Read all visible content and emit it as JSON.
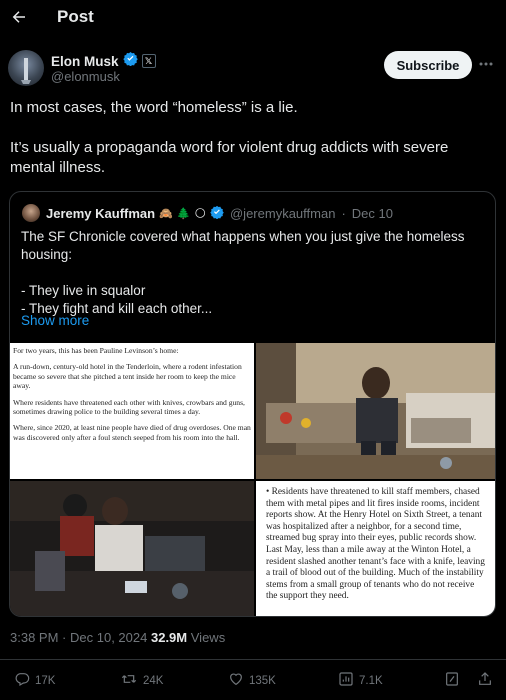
{
  "header": {
    "title": "Post"
  },
  "author": {
    "name": "Elon Musk",
    "handle": "@elonmusk",
    "verified_color": "#1d9bf0"
  },
  "subscribe_label": "Subscribe",
  "post": {
    "para1": "In most cases, the word “homeless” is a lie.",
    "para2": "It’s usually a propaganda word for violent drug addicts with severe mental illness."
  },
  "quote": {
    "name": "Jeremy Kauffman",
    "handle": "@jeremykauffman",
    "separator": "·",
    "date": "Dec 10",
    "emoji": [
      "🙈",
      "🌲",
      "🌕"
    ],
    "text": "The SF Chronicle covered what happens when you just give the homeless housing:\n\n- They live in squalor\n- They fight and kill each other...",
    "show_more": "Show more",
    "article1": [
      "For two years, this has been Pauline Levinson’s home:",
      "A run-down, century-old hotel in the Tenderloin, where a rodent infestation became so severe that she pitched a tent inside her room to keep the mice away.",
      "Where residents have threatened each other with knives, crowbars and guns, sometimes drawing police to the building several times a day.",
      "Where, since 2020, at least nine people have died of drug overdoses. One man was discovered only after a foul stench seeped from his room into the hall."
    ],
    "article2": "• Residents have threatened to kill staff members, chased them with metal pipes and lit fires inside rooms, incident reports show. At the Henry Hotel on Sixth Street, a tenant was hospitalized after a neighbor, for a second time, streamed bug spray into their eyes, public records show. Last May, less than a mile away at the Winton Hotel, a resident slashed another tenant’s face with a knife, leaving a trail of blood out of the building. Much of the instability stems from a small group of tenants who do not receive the support they need."
  },
  "meta": {
    "time": "3:38 PM",
    "sep": "·",
    "date": "Dec 10, 2024",
    "views_count": "32.9M",
    "views_label": "Views"
  },
  "actions": {
    "replies": "17K",
    "reposts": "24K",
    "likes": "135K",
    "bookmarks": "7.1K"
  }
}
